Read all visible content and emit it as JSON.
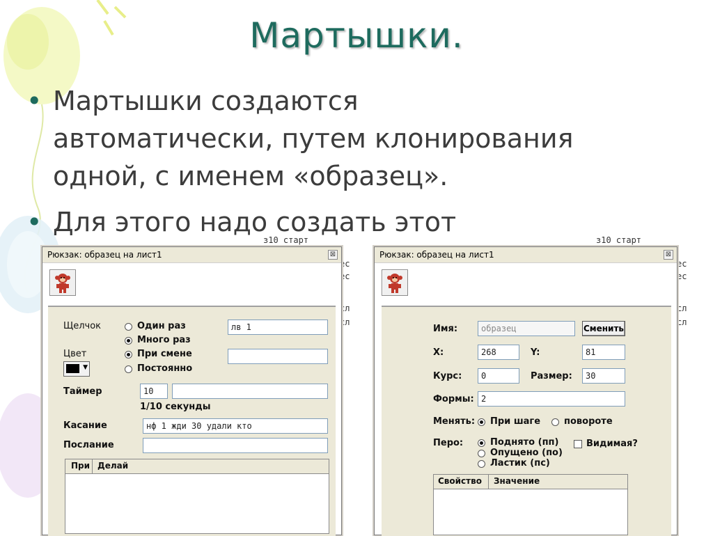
{
  "slide": {
    "title": "Мартышки.",
    "bullets": [
      [
        "Мартышки создаются",
        "автоматически, путем клонирования",
        "одной, с именем «образец»."
      ],
      [
        "Для этого надо создать этот"
      ]
    ],
    "bullet_mark": "•"
  },
  "background_text": {
    "left": [
      "з10 старт",
      "ес",
      "ес",
      "сл",
      "сл"
    ],
    "right": [
      "з10 старт",
      "ес",
      "ес",
      "сл",
      "сл"
    ]
  },
  "left_window": {
    "title": "Рюкзак: образец на лист1",
    "close": "⊠",
    "click_label": "Щелчок",
    "click_options": [
      "Один раз",
      "Много раз",
      "При смене",
      "Постоянно"
    ],
    "click_selected": "Много раз",
    "click_value": "лв 1",
    "extra_value": "",
    "color_label": "Цвет",
    "color_value": "#000000",
    "timer_label": "Таймер",
    "timer_value": "10",
    "timer_unit": "1/10 секунды",
    "touch_label": "Касание",
    "touch_value": "нф 1 жди 30 удали кто",
    "message_label": "Послание",
    "message_value": "",
    "table_cols": [
      "При",
      "Делай"
    ]
  },
  "right_window": {
    "title": "Рюкзак: образец на лист1",
    "close": "⊠",
    "name_label": "Имя:",
    "name_value": "образец",
    "change_button": "Сменить",
    "x_label": "X:",
    "x_value": "268",
    "y_label": "Y:",
    "y_value": "81",
    "heading_label": "Курс:",
    "heading_value": "0",
    "size_label": "Размер:",
    "size_value": "30",
    "shapes_label": "Формы:",
    "shapes_value": "2",
    "change_label": "Менять:",
    "change_options": [
      "При шаге",
      "повороте"
    ],
    "pen_label": "Перо:",
    "pen_options": [
      "Поднято (пп)",
      "Опущено (по)",
      "Ластик (пс)"
    ],
    "visible_label": "Видимая?",
    "table_cols": [
      "Свойство",
      "Значение"
    ]
  }
}
